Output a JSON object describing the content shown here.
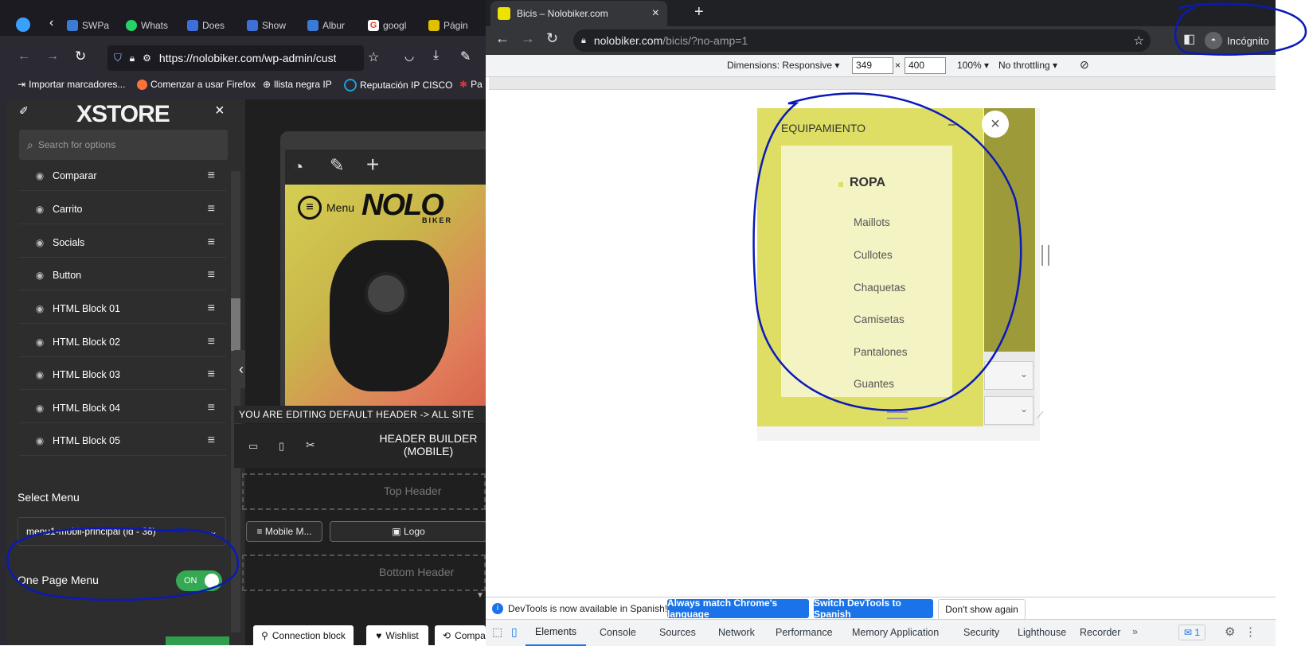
{
  "firefox": {
    "tabs": [
      {
        "label": "SWPa",
        "color": "#3a7bd5"
      },
      {
        "label": "Whats",
        "color": "#25d366"
      },
      {
        "label": "Does",
        "color": "#3d6fd8"
      },
      {
        "label": "Show",
        "color": "#3d6fd8"
      },
      {
        "label": "Albur",
        "color": "#3a7bd5"
      },
      {
        "label": "googl",
        "color": "#ea4335"
      },
      {
        "label": "Págin",
        "color": "#e0c000"
      }
    ],
    "url": "https://nolobiker.com/wp-admin/cust",
    "bookmarks": [
      "Importar marcadores...",
      "Comenzar a usar Firefox",
      "llista negra IP",
      "Reputación IP CISCO",
      "Pa"
    ]
  },
  "xstore": {
    "logo": "XSTORE",
    "search_placeholder": "Search for options",
    "items": [
      "Comparar",
      "Carrito",
      "Socials",
      "Button",
      "HTML Block 01",
      "HTML Block 02",
      "HTML Block 03",
      "HTML Block 04",
      "HTML Block 05"
    ],
    "select_menu_label": "Select Menu",
    "select_menu_value": "menu1-mobil-principal (id - 38)",
    "one_page_label": "One Page Menu",
    "toggle_label": "ON"
  },
  "preview": {
    "menu_label": "Menu",
    "brand": "NOLO",
    "brand_sub": "BIKER",
    "editing_notice": "YOU ARE EDITING DEFAULT HEADER -> ALL SITE",
    "builder_title": "HEADER BUILDER",
    "builder_sub": "(MOBILE)",
    "top_header": "Top Header",
    "mobile_menu_btn": "Mobile M...",
    "logo_btn": "Logo",
    "bottom_header": "Bottom Header",
    "bottom_tabs": [
      "Connection block",
      "Wishlist",
      "Compa"
    ]
  },
  "chrome": {
    "tab_title": "Bicis – Nolobiker.com",
    "url_host": "nolobiker.com",
    "url_path": "/bicis/?no-amp=1",
    "incognito": "Incógnito",
    "dimensions_label": "Dimensions: Responsive",
    "width": "349",
    "height": "400",
    "zoom": "100%",
    "throttle": "No throttling",
    "menu_header": "EQUIPAMIENTO",
    "menu_section": "ROPA",
    "menu_items": [
      "Maillots",
      "Cullotes",
      "Chaquetas",
      "Camisetas",
      "Pantalones",
      "Guantes"
    ],
    "devtools_notice": "DevTools is now available in Spanish!",
    "btn_match": "Always match Chrome's language",
    "btn_switch": "Switch DevTools to Spanish",
    "btn_dont": "Don't show again",
    "devtools_tabs": [
      "Elements",
      "Console",
      "Sources",
      "Network",
      "Performance",
      "Memory",
      "Application",
      "Security",
      "Lighthouse",
      "Recorder"
    ],
    "issues_count": "1"
  },
  "colors": {
    "annotation": "#0a1ab8",
    "phone_bg": "#dede64",
    "submenu_bg": "#f4f3c4",
    "dt_blue": "#1a73e8"
  }
}
